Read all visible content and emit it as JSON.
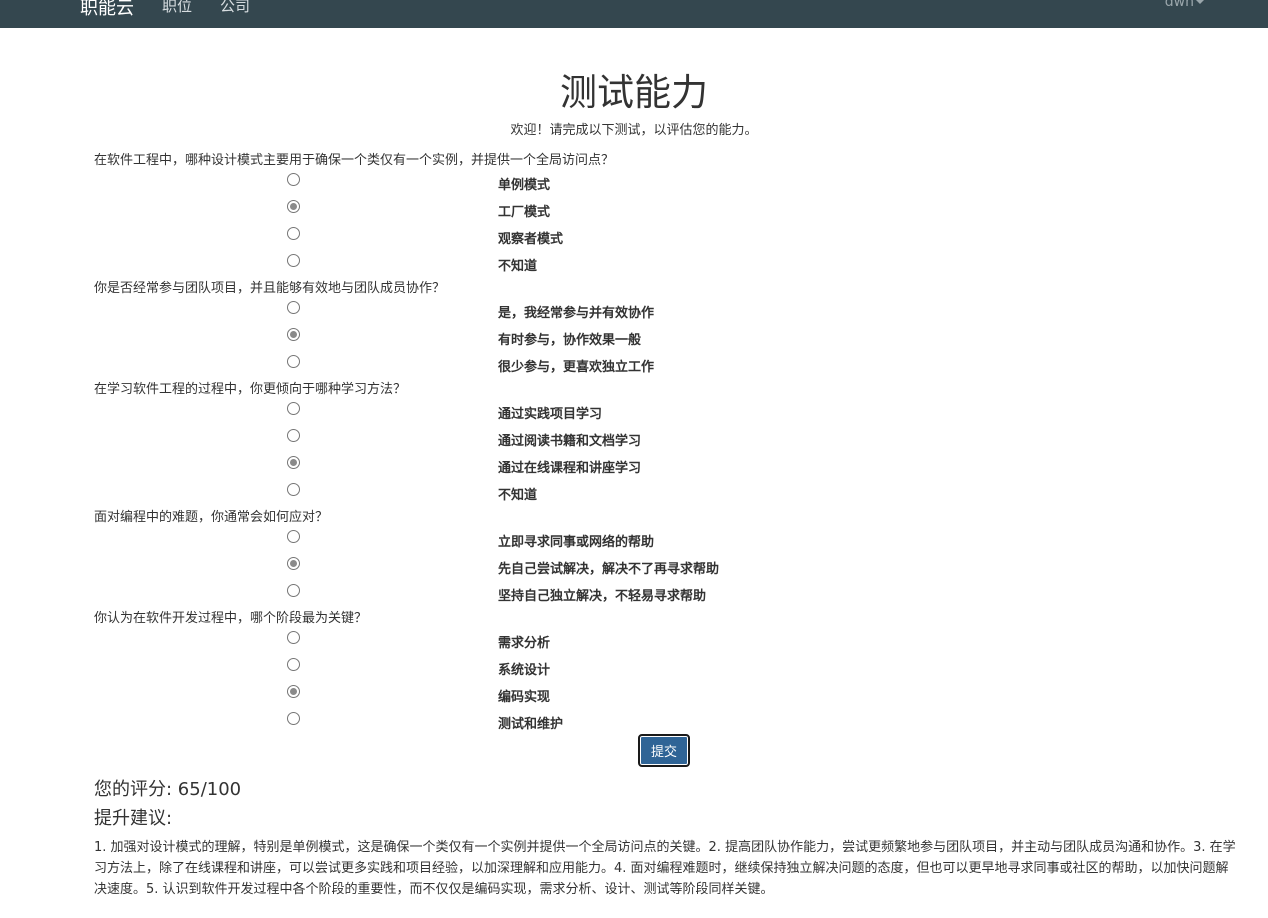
{
  "navbar": {
    "brand": "职能云",
    "links": [
      "职位",
      "公司"
    ],
    "user": "dwn"
  },
  "header": {
    "title": "测试能力",
    "welcome": "欢迎！请完成以下测试，以评估您的能力。"
  },
  "questions": [
    {
      "text": "在软件工程中，哪种设计模式主要用于确保一个类仅有一个实例，并提供一个全局访问点？",
      "options": [
        "单例模式",
        "工厂模式",
        "观察者模式",
        "不知道"
      ],
      "selected": 1
    },
    {
      "text": "你是否经常参与团队项目，并且能够有效地与团队成员协作？",
      "options": [
        "是，我经常参与并有效协作",
        "有时参与，协作效果一般",
        "很少参与，更喜欢独立工作"
      ],
      "selected": 1
    },
    {
      "text": "在学习软件工程的过程中，你更倾向于哪种学习方法？",
      "options": [
        "通过实践项目学习",
        "通过阅读书籍和文档学习",
        "通过在线课程和讲座学习",
        "不知道"
      ],
      "selected": 2
    },
    {
      "text": "面对编程中的难题，你通常会如何应对？",
      "options": [
        "立即寻求同事或网络的帮助",
        "先自己尝试解决，解决不了再寻求帮助",
        "坚持自己独立解决，不轻易寻求帮助"
      ],
      "selected": 1
    },
    {
      "text": "你认为在软件开发过程中，哪个阶段最为关键？",
      "options": [
        "需求分析",
        "系统设计",
        "编码实现",
        "测试和维护"
      ],
      "selected": 2
    }
  ],
  "form": {
    "submit_label": "提交"
  },
  "result": {
    "score_text": "您的评分: 65/100",
    "advice_heading": "提升建议:",
    "advice_text": "1. 加强对设计模式的理解，特别是单例模式，这是确保一个类仅有一个实例并提供一个全局访问点的关键。2. 提高团队协作能力，尝试更频繁地参与团队项目，并主动与团队成员沟通和协作。3. 在学习方法上，除了在线课程和讲座，可以尝试更多实践和项目经验，以加深理解和应用能力。4. 面对编程难题时，继续保持独立解决问题的态度，但也可以更早地寻求同事或社区的帮助，以加快问题解决速度。5. 认识到软件开发过程中各个阶段的重要性，而不仅仅是编码实现，需求分析、设计、测试等阶段同样关键。"
  },
  "colors": {
    "navbar_bg": "#34474f",
    "submit_bg": "#2f6496"
  }
}
